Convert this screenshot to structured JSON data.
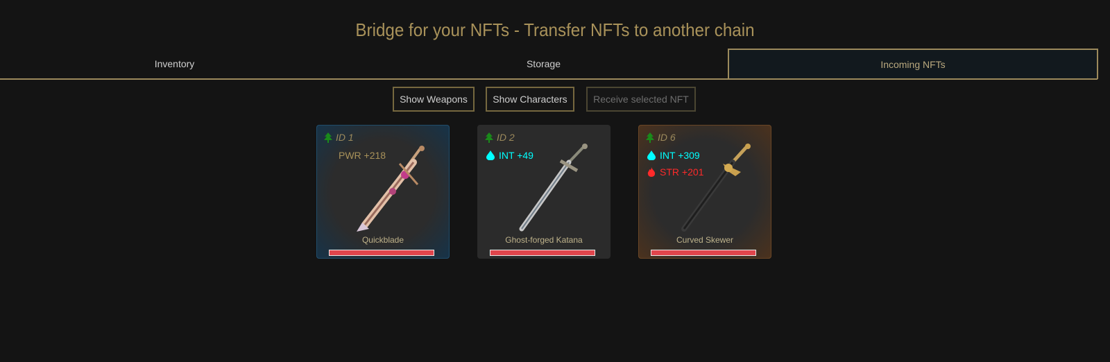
{
  "page": {
    "title": "Bridge for your NFTs - Transfer NFTs to another chain"
  },
  "tabs": [
    {
      "label": "Inventory",
      "active": false
    },
    {
      "label": "Storage",
      "active": false
    },
    {
      "label": "Incoming NFTs",
      "active": true
    }
  ],
  "actions": {
    "show_weapons": "Show Weapons",
    "show_characters": "Show Characters",
    "receive_selected": "Receive selected NFT"
  },
  "colors": {
    "accent": "#9c8a5c",
    "int": "#00ffff",
    "str": "#ff2a2a",
    "pwr": "#a9925a",
    "earth": "#1a8a1a",
    "bar": "#e0454c"
  },
  "weapons": [
    {
      "id_label": "ID 1",
      "element_icon": "tree-icon",
      "stats": [
        {
          "icon": "none",
          "text": "PWR +218"
        }
      ],
      "name": "Quickblade"
    },
    {
      "id_label": "ID 2",
      "element_icon": "tree-icon",
      "stats": [
        {
          "icon": "water-drop-icon",
          "text": "INT +49"
        }
      ],
      "name": "Ghost-forged Katana"
    },
    {
      "id_label": "ID 6",
      "element_icon": "tree-icon",
      "stats": [
        {
          "icon": "water-drop-icon",
          "text": "INT +309"
        },
        {
          "icon": "fire-icon",
          "text": "STR +201"
        }
      ],
      "name": "Curved Skewer"
    }
  ]
}
